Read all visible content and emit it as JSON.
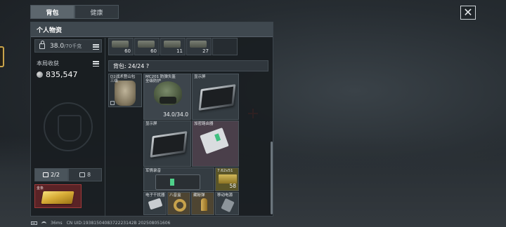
{
  "tabs": [
    {
      "label": "背包",
      "active": true
    },
    {
      "label": "健康",
      "active": false
    }
  ],
  "close_icon": "close-icon",
  "panel": {
    "title": "个人物资",
    "weight": {
      "current": "38.0",
      "max_unit": "/70千克"
    },
    "earnings": {
      "label": "本局收获",
      "value": "835,547"
    },
    "slot_tabs": [
      {
        "label": "2/2",
        "icon": "backpack-icon",
        "active": true
      },
      {
        "label": "8",
        "icon": "safe-icon",
        "active": false
      }
    ],
    "gold_item": {
      "label": "金条"
    },
    "stacks": [
      {
        "qty": "60"
      },
      {
        "qty": "60"
      },
      {
        "qty": "11"
      },
      {
        "qty": "27"
      },
      {
        "qty": ""
      }
    ],
    "backpack_capacity": "背包: 24/24 ?",
    "items": {
      "vest_label": "D2战术登山包\n三级",
      "helmet_label": "MC201 防弹头盔\n全级防护",
      "helmet_durability": "34.0/34.0",
      "display1_label": "显示屏",
      "display2_label": "显示屏",
      "router_label": "加密路由器",
      "device_label": "军情录音",
      "ammo_label": "7.62x51",
      "ammo_qty": "58",
      "jammer_label": "电子干扰器",
      "ring_label": "八音盒",
      "shell_label": "藏秘弹",
      "battery_label": "移动电源"
    }
  },
  "status_bar": {
    "ping": "36ms",
    "uid": "CN UID:1938150408372223142B 202508051606"
  },
  "colors": {
    "gold_card_border": "#a03a3a",
    "crosshair": "#c0392b",
    "accent_green": "#4fd08a"
  }
}
